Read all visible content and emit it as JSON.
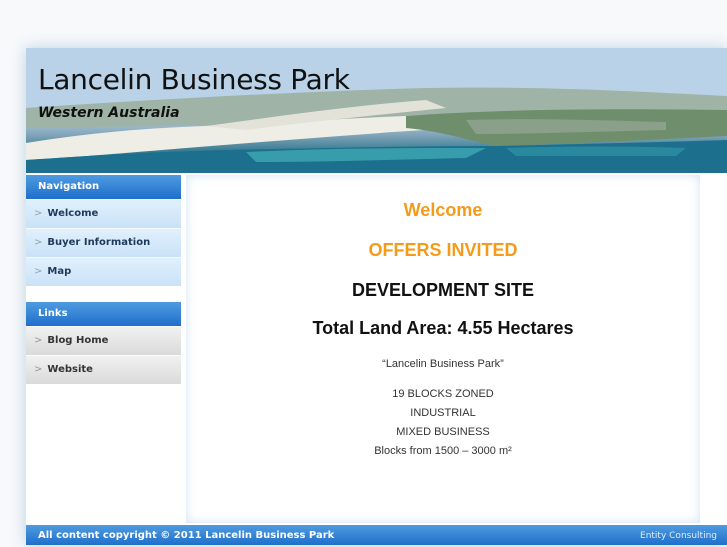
{
  "header": {
    "title": "Lancelin Business Park",
    "subtitle": "Western Australia"
  },
  "navigation": {
    "heading": "Navigation",
    "items": [
      {
        "label": "Welcome"
      },
      {
        "label": "Buyer Information"
      },
      {
        "label": "Map"
      }
    ]
  },
  "links": {
    "heading": "Links",
    "items": [
      {
        "label": "Blog Home"
      },
      {
        "label": "Website"
      }
    ]
  },
  "content": {
    "welcome": "Welcome",
    "offers": "OFFERS INVITED",
    "development": "DEVELOPMENT SITE",
    "land_area": "Total Land Area: 4.55 Hectares",
    "quote": "“Lancelin Business Park”",
    "details": [
      "19 BLOCKS ZONED",
      "INDUSTRIAL",
      "MIXED BUSINESS",
      "Blocks from 1500 – 3000 m²"
    ]
  },
  "footer": {
    "copyright": "All content copyright © 2011 Lancelin Business Park",
    "credit": "Entity Consulting"
  },
  "colors": {
    "accent_orange": "#f49b1a",
    "nav_blue": "#1f6fcb",
    "nav_item_bg": "#c9e2f8",
    "link_item_bg": "#dadada"
  },
  "icons": {
    "nav_chevron": "chevron-right-icon"
  }
}
